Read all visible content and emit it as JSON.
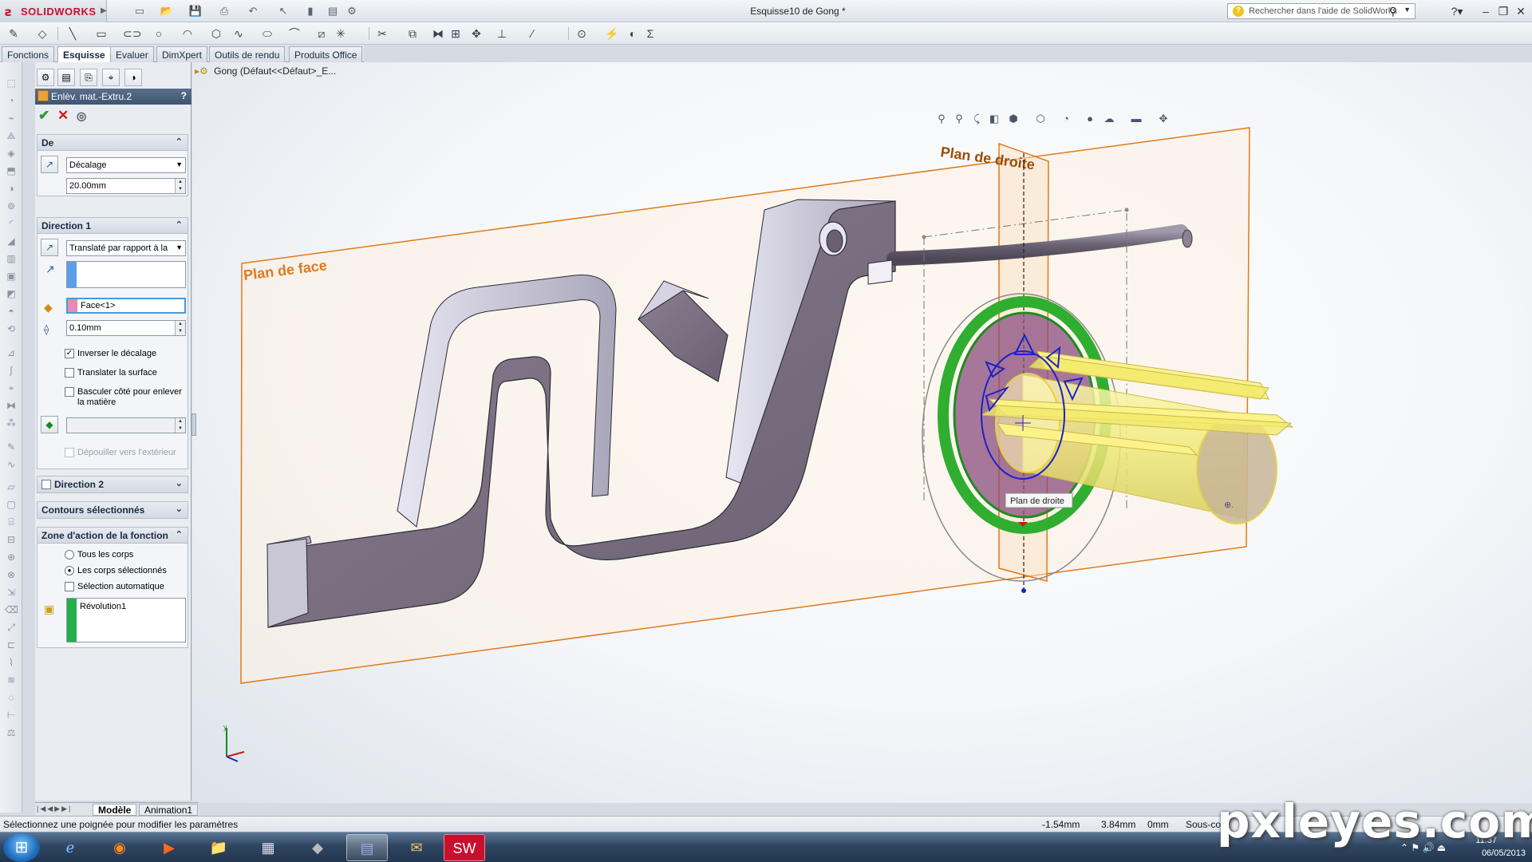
{
  "app": {
    "logo_text": "SOLIDWORKS",
    "document_title": "Esquisse10 de Gong *",
    "help_search_placeholder": "Rechercher dans l'aide de SolidWorks"
  },
  "tabs": [
    {
      "label": "Fonctions"
    },
    {
      "label": "Esquisse",
      "active": true
    },
    {
      "label": "Evaluer"
    },
    {
      "label": "DimXpert"
    },
    {
      "label": "Outils de rendu"
    },
    {
      "label": "Produits Office"
    }
  ],
  "feature_tree": {
    "root": "Gong  (Défaut<<Défaut>_E..."
  },
  "property_manager": {
    "title": "Enlèv. mat.-Extru.2",
    "help": "?",
    "de": {
      "header": "De",
      "type": "Décalage",
      "offset": "20.00mm"
    },
    "direction1": {
      "header": "Direction 1",
      "type": "Translaté par rapport à la",
      "face": "Face<1>",
      "offset": "0.10mm",
      "inverser": "Inverser le décalage",
      "translater": "Translater la surface",
      "basculer": "Basculer côté pour enlever la matière",
      "depouiller": "Dépouiller vers l'extérieur"
    },
    "direction2": {
      "header": "Direction 2"
    },
    "contours": {
      "header": "Contours sélectionnés"
    },
    "zone": {
      "header": "Zone d'action de la fonction",
      "tous": "Tous les corps",
      "selectionnes": "Les corps sélectionnés",
      "auto": "Sélection automatique",
      "body": "Révolution1"
    }
  },
  "viewport": {
    "plane_face_label": "Plan de face",
    "plane_right_label": "Plan de droite",
    "tooltip": "Plan de droite"
  },
  "bottom_tabs": [
    {
      "label": "Modèle",
      "active": true
    },
    {
      "label": "Animation1"
    }
  ],
  "status": {
    "message": "Sélectionnez une poignée pour modifier les paramètres",
    "x": "-1.54mm",
    "y": "3.84mm",
    "z": "0mm",
    "mode": "Sous-co"
  },
  "taskbar": {
    "time": "11:37",
    "date": "06/05/2013"
  },
  "watermark": "pxleyes.com",
  "colors": {
    "plane_orange": "#e07a1a",
    "body_purple": "#7a6d80",
    "preview_yellow": "#f6ef7a",
    "ring_green": "#2fae2f",
    "sketch_blue": "#1a22c8"
  }
}
